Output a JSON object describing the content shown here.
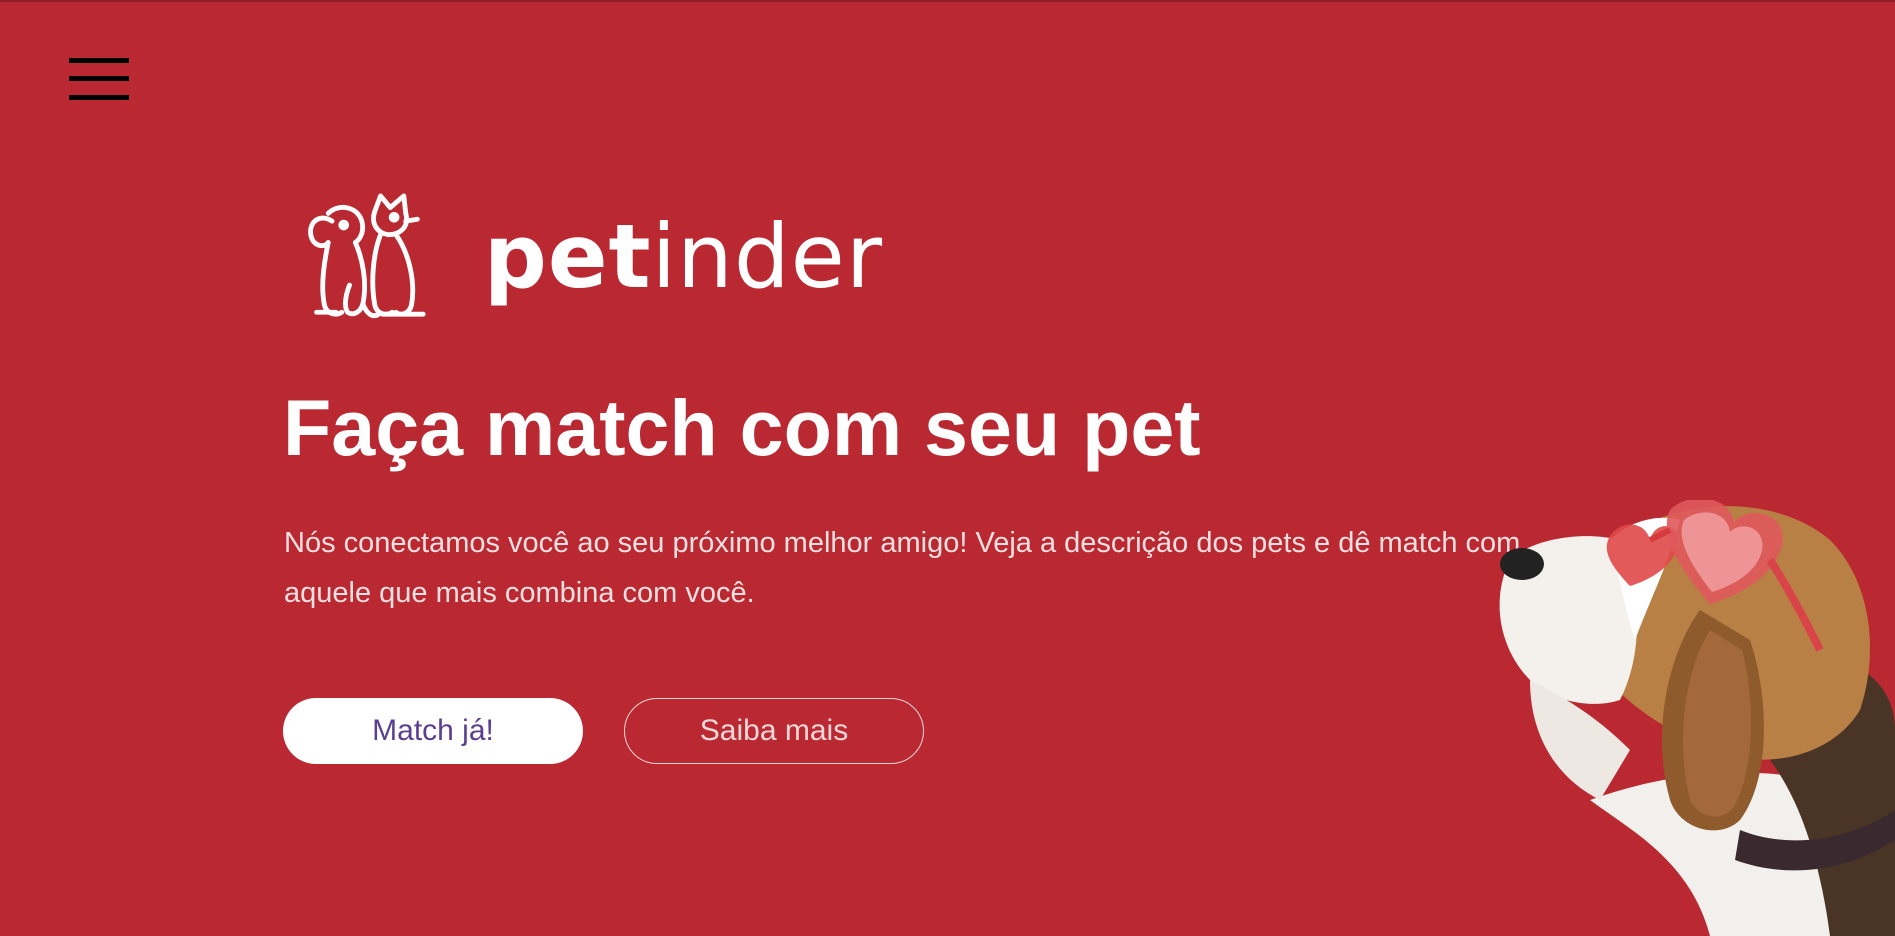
{
  "header": {
    "menu_icon": "hamburger-menu-icon"
  },
  "brand": {
    "logo_icon": "dog-and-cat-logo-icon",
    "name_bold": "pet",
    "name_light": "inder"
  },
  "hero": {
    "title": "Faça match com seu pet",
    "description": "Nós conectamos você ao seu próximo melhor amigo! Veja a descrição dos pets e dê match com aquele que mais combina com você.",
    "primary_button": "Match já!",
    "secondary_button": "Saiba mais",
    "image_icon": "beagle-with-heart-sunglasses-image"
  },
  "colors": {
    "background": "#ba2932",
    "primary_button_bg": "#ffffff",
    "primary_button_text": "#5a3f8e",
    "secondary_button_border": "#f3d6d8"
  }
}
